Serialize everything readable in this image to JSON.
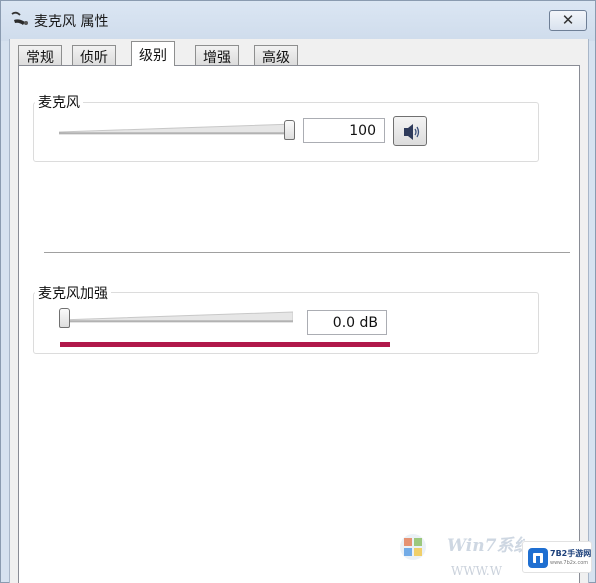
{
  "window": {
    "title": "麦克风 属性",
    "close_glyph": "✕"
  },
  "tabs": [
    {
      "label": "常规",
      "active": false
    },
    {
      "label": "侦听",
      "active": false
    },
    {
      "label": "级别",
      "active": true
    },
    {
      "label": "增强",
      "active": false
    },
    {
      "label": "高级",
      "active": false
    }
  ],
  "microphone": {
    "label": "麦克风",
    "level_fraction": 1.0,
    "value": "100",
    "mute_button_icon": "speaker-icon"
  },
  "boost": {
    "label": "麦克风加强",
    "level_fraction": 0.0,
    "value": "0.0 dB"
  },
  "watermark": {
    "text": "Win7系统",
    "url_text": "WWW.W",
    "site_label": "7B2手游网",
    "site_url": "www.7b2x.com"
  },
  "colors": {
    "meter": "#b0184a",
    "window_frame": "#d8e4f1"
  }
}
